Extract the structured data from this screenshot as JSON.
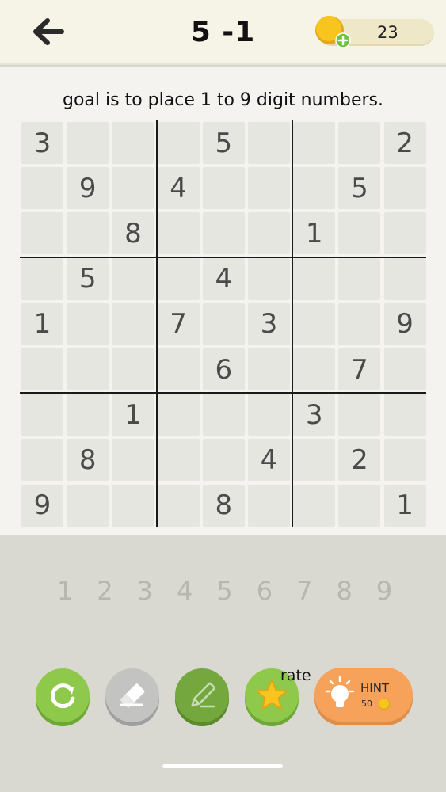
{
  "header": {
    "back_icon": "arrow-left-icon",
    "level": "5 -1",
    "coins": "23",
    "coin_icon": "coin-plus-icon"
  },
  "instruction": "goal is to place 1 to 9 digit numbers.",
  "board": {
    "rows": [
      [
        "3",
        "",
        "",
        "",
        "5",
        "",
        "",
        "",
        "2"
      ],
      [
        "",
        "9",
        "",
        "4",
        "",
        "",
        "",
        "5",
        ""
      ],
      [
        "",
        "",
        "8",
        "",
        "",
        "",
        "1",
        "",
        ""
      ],
      [
        "",
        "5",
        "",
        "",
        "4",
        "",
        "",
        "",
        ""
      ],
      [
        "1",
        "",
        "",
        "7",
        "",
        "3",
        "",
        "",
        "9"
      ],
      [
        "",
        "",
        "",
        "",
        "6",
        "",
        "",
        "7",
        ""
      ],
      [
        "",
        "",
        "1",
        "",
        "",
        "",
        "3",
        "",
        ""
      ],
      [
        "",
        "8",
        "",
        "",
        "",
        "4",
        "",
        "2",
        ""
      ],
      [
        "9",
        "",
        "",
        "",
        "8",
        "",
        "",
        "",
        "1"
      ]
    ]
  },
  "numpad": [
    "1",
    "2",
    "3",
    "4",
    "5",
    "6",
    "7",
    "8",
    "9"
  ],
  "tools": {
    "restart_icon": "restart-icon",
    "erase_icon": "eraser-icon",
    "pencil_icon": "pencil-icon",
    "rate_icon": "star-icon",
    "rate_label": "rate",
    "hint_label": "HINT",
    "hint_cost": "50",
    "hint_icon": "lightbulb-icon"
  },
  "colors": {
    "header_bg": "#f6f4e6",
    "cell_bg": "#e6e6e1",
    "given_digit": "#4a4a4a",
    "numpad_digit": "#b7b7b2",
    "green_button": "#8fc94c",
    "hint_button": "#f6a25a",
    "coin": "#f7c51d"
  }
}
